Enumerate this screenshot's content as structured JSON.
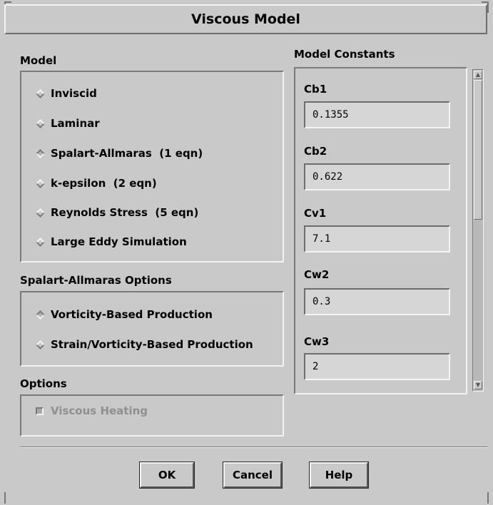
{
  "window": {
    "title": "Viscous Model"
  },
  "model": {
    "label": "Model",
    "options": [
      {
        "label": "Inviscid",
        "selected": false
      },
      {
        "label": "Laminar",
        "selected": false
      },
      {
        "label": "Spalart-Allmaras  (1 eqn)",
        "selected": true
      },
      {
        "label": "k-epsilon  (2 eqn)",
        "selected": false
      },
      {
        "label": "Reynolds Stress  (5 eqn)",
        "selected": false
      },
      {
        "label": "Large Eddy Simulation",
        "selected": false
      }
    ]
  },
  "sa_options": {
    "label": "Spalart-Allmaras Options",
    "options": [
      {
        "label": "Vorticity-Based Production",
        "selected": true
      },
      {
        "label": "Strain/Vorticity-Based Production",
        "selected": false
      }
    ]
  },
  "options": {
    "label": "Options",
    "viscous_heating": {
      "label": "Viscous Heating",
      "checked": false,
      "enabled": false
    }
  },
  "constants": {
    "label": "Model Constants",
    "items": [
      {
        "name": "Cb1",
        "value": "0.1355"
      },
      {
        "name": "Cb2",
        "value": "0.622"
      },
      {
        "name": "Cv1",
        "value": "7.1"
      },
      {
        "name": "Cw2",
        "value": "0.3"
      },
      {
        "name": "Cw3",
        "value": "2"
      }
    ]
  },
  "buttons": {
    "ok": "OK",
    "cancel": "Cancel",
    "help": "Help"
  }
}
